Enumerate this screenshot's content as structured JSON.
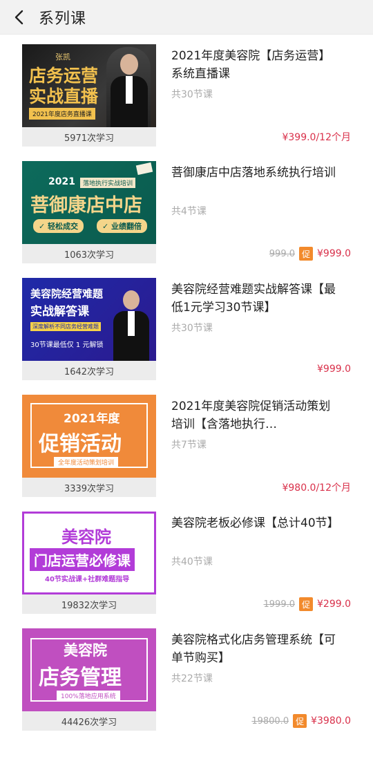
{
  "header": {
    "title": "系列课"
  },
  "courses": [
    {
      "thumb": {
        "name": "张凯",
        "line1": "店务运营",
        "line2": "实战直播",
        "tag": "2021年度店务直播课"
      },
      "learners": "5971次学习",
      "title": "2021年度美容院【店务运营】系统直播课",
      "lessons": "共30节课",
      "original_price": "",
      "promo": "",
      "price": "¥399.0/12个月"
    },
    {
      "thumb": {
        "year": "2021",
        "ribbon": "落地执行实战培训",
        "main": "菩御康店中店",
        "pill1": "✓ 轻松成交",
        "pill2": "✓ 业绩翻倍"
      },
      "learners": "1063次学习",
      "title": "菩御康店中店落地系统执行培训",
      "lessons": "共4节课",
      "original_price": "999.0",
      "promo": "促",
      "price": "¥999.0"
    },
    {
      "thumb": {
        "line1": "美容院经营难题",
        "line2": "实战解答课",
        "tag": "深度解析不同店务经营难题",
        "bottom": "30节课最低仅 1 元解锁"
      },
      "learners": "1642次学习",
      "title": "美容院经营难题实战解答课【最低1元学习30节课】",
      "lessons": "共30节课",
      "original_price": "",
      "promo": "",
      "price": "¥999.0"
    },
    {
      "thumb": {
        "year": "2021年度",
        "main": "促销活动",
        "tag": "全年度活动策划培训"
      },
      "learners": "3339次学习",
      "title": "2021年度美容院促销活动策划培训【含落地执行…",
      "lessons": "共7节课",
      "original_price": "",
      "promo": "",
      "price": "¥980.0/12个月"
    },
    {
      "thumb": {
        "top": "美容院",
        "main": "门店运营必修课",
        "tag": "40节实战课+社群难题指导"
      },
      "learners": "19832次学习",
      "title": "美容院老板必修课【总计40节】",
      "lessons": "共40节课",
      "original_price": "1999.0",
      "promo": "促",
      "price": "¥299.0"
    },
    {
      "thumb": {
        "top": "美容院",
        "main": "店务管理",
        "tag": "100%落地应用系统"
      },
      "learners": "44426次学习",
      "title": "美容院格式化店务管理系统【可单节购买】",
      "lessons": "共22节课",
      "original_price": "19800.0",
      "promo": "促",
      "price": "¥3980.0"
    }
  ],
  "colors": {
    "price": "#d9304a",
    "promo": "#f28a2c"
  }
}
